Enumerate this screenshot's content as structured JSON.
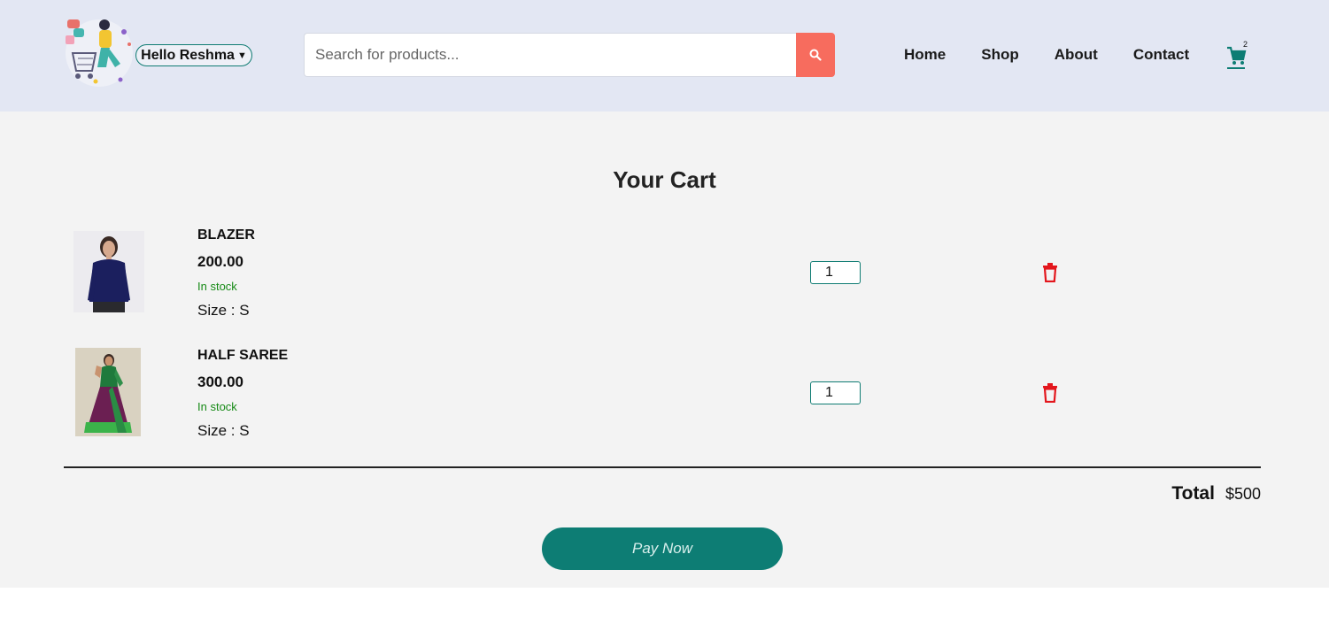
{
  "header": {
    "user_label": "Hello Reshma",
    "search": {
      "placeholder": "Search for products..."
    },
    "nav": [
      "Home",
      "Shop",
      "About",
      "Contact"
    ],
    "cart_count": "2"
  },
  "cart": {
    "title": "Your Cart",
    "items": [
      {
        "name": "BLAZER",
        "price": "200.00",
        "stock": "In stock",
        "size": "Size : S",
        "qty": "1"
      },
      {
        "name": "HALF SAREE",
        "price": "300.00",
        "stock": "In stock",
        "size": "Size : S",
        "qty": "1"
      }
    ],
    "total_label": "Total",
    "total_value": "$500",
    "pay_label": "Pay Now"
  },
  "colors": {
    "accent": "#0d7d74",
    "search_button": "#f76c5e",
    "danger": "#e3161c",
    "header_bg": "#e3e7f3"
  }
}
